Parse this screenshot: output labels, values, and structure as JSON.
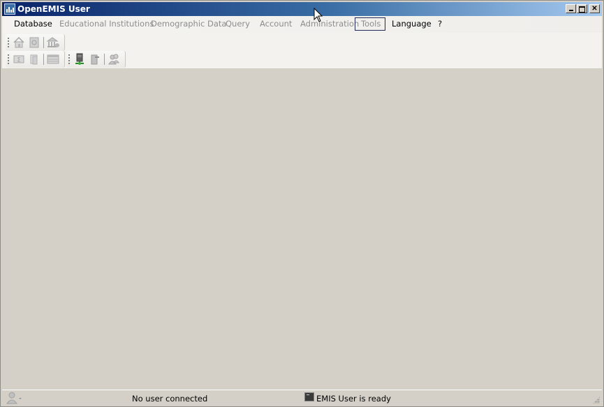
{
  "window": {
    "title": "OpenEMIS User",
    "controls": {
      "minimize": "minimize",
      "maximize": "maximize",
      "close": "close"
    }
  },
  "menubar": {
    "items": [
      {
        "label": "Database",
        "enabled": true
      },
      {
        "label": "Educational Institutions",
        "enabled": false
      },
      {
        "label": "Demographic Data",
        "enabled": false
      },
      {
        "label": "Query",
        "enabled": false
      },
      {
        "label": "Account",
        "enabled": false
      },
      {
        "label": "Administration",
        "enabled": false
      },
      {
        "label": "Tools",
        "enabled": false,
        "hovered": true
      },
      {
        "label": "Language",
        "enabled": true
      },
      {
        "label": "?",
        "enabled": true
      }
    ]
  },
  "toolbars": {
    "row1": [
      {
        "icon": "house-icon",
        "enabled": false
      },
      {
        "icon": "address-book-icon",
        "enabled": false
      },
      {
        "icon": "institution-add-icon",
        "enabled": false
      }
    ],
    "row2a": [
      {
        "icon": "sigma-report-icon",
        "enabled": false
      },
      {
        "icon": "documents-icon",
        "enabled": false
      },
      {
        "icon": "grid-icon",
        "enabled": false
      }
    ],
    "row2b": [
      {
        "icon": "server-connect-icon",
        "enabled": true
      },
      {
        "icon": "server-disconnect-icon",
        "enabled": false
      },
      {
        "icon": "users-icon",
        "enabled": false
      }
    ]
  },
  "statusbar": {
    "user_status": "No user connected",
    "app_status": "EMIS User is ready"
  },
  "colors": {
    "title_start": "#0a246a",
    "title_end": "#a6caf0",
    "background": "#d4d0c8",
    "disabled_text": "#8d8d8d"
  }
}
